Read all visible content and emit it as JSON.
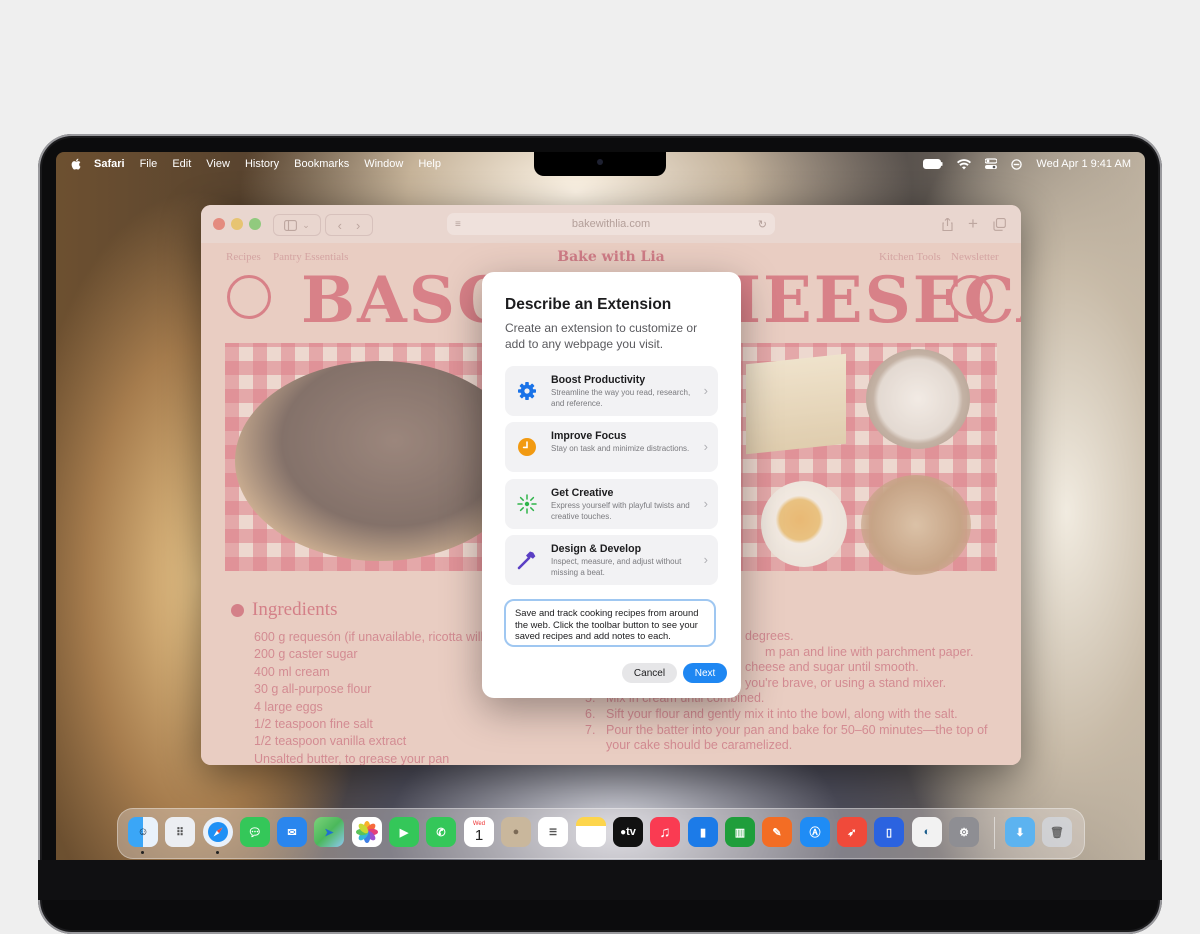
{
  "menubar": {
    "items": [
      "Safari",
      "File",
      "Edit",
      "View",
      "History",
      "Bookmarks",
      "Window",
      "Help"
    ],
    "clock": "Wed Apr 1  9:41 AM"
  },
  "safari": {
    "url": "bakewithlia.com"
  },
  "webpage": {
    "nav_left": [
      "Recipes",
      "Pantry Essentials"
    ],
    "brand": "Bake with Lia",
    "nav_right": [
      "Kitchen Tools",
      "Newsletter"
    ],
    "title": "BASQUE CHEESECAKE",
    "ingredients_heading": "Ingredients",
    "ingredients": [
      "600 g requesón (if unavailable, ricotta will w",
      "200 g caster sugar",
      "400 ml cream",
      "30 g all-purpose flour",
      "4 large eggs",
      "1/2 teaspoon fine salt",
      "1/2 teaspoon vanilla extract",
      "Unsalted butter, to grease your pan"
    ],
    "steps": [
      {
        "n": "",
        "text": "degrees."
      },
      {
        "n": "",
        "text": "m pan and line with parchment paper."
      },
      {
        "n": "",
        "text": "cheese and sugar until smooth."
      },
      {
        "n": "",
        "text": "you're brave, or using a stand mixer."
      },
      {
        "n": "5.",
        "text": "Mix in cream until combined."
      },
      {
        "n": "6.",
        "text": "Sift your flour and gently mix it into the bowl, along with the salt."
      },
      {
        "n": "7.",
        "text": "Pour the batter into your pan and bake for 50–60 minutes—the top of your cake should be caramelized."
      }
    ]
  },
  "dialog": {
    "title": "Describe an Extension",
    "subtitle": "Create an extension to customize or add to any webpage you visit.",
    "options": [
      {
        "title": "Boost Productivity",
        "desc": "Streamline the way you read, research, and reference.",
        "icon": "gear-icon",
        "color": "#1a73e8"
      },
      {
        "title": "Improve Focus",
        "desc": "Stay on task and minimize distractions.",
        "icon": "clock-icon",
        "color": "#f29a11"
      },
      {
        "title": "Get Creative",
        "desc": "Express yourself with playful twists and creative touches.",
        "icon": "sparkle-icon",
        "color": "#2fb44a"
      },
      {
        "title": "Design & Develop",
        "desc": "Inspect, measure, and adjust without missing a beat.",
        "icon": "hammer-icon",
        "color": "#5b3fc4"
      }
    ],
    "prompt_text": "Save and track cooking recipes from around the web. Click the toolbar button to see your saved recipes and add notes to each.",
    "cancel_label": "Cancel",
    "next_label": "Next"
  },
  "dock": {
    "calendar_month": "Wed",
    "calendar_day": "1",
    "tv_label": "tv",
    "apps": [
      {
        "name": "Finder",
        "color": "#2a8cf0"
      },
      {
        "name": "Launchpad",
        "color": "#e9e9ee"
      },
      {
        "name": "Safari",
        "color": "#1e90f5"
      },
      {
        "name": "Messages",
        "color": "#34c759"
      },
      {
        "name": "Mail",
        "color": "#2a86ee"
      },
      {
        "name": "Maps",
        "color": "#4bb85b"
      },
      {
        "name": "Photos",
        "color": "#f4f4f4"
      },
      {
        "name": "FaceTime",
        "color": "#34c759"
      },
      {
        "name": "Phone",
        "color": "#34c759"
      },
      {
        "name": "Calendar",
        "color": "#ffffff"
      },
      {
        "name": "Contacts",
        "color": "#c9b79c"
      },
      {
        "name": "Reminders",
        "color": "#ffffff"
      },
      {
        "name": "Notes",
        "color": "#fdd54c"
      },
      {
        "name": "TV",
        "color": "#111111"
      },
      {
        "name": "Music",
        "color": "#fa3b52"
      },
      {
        "name": "Keynote",
        "color": "#1c7be8"
      },
      {
        "name": "Numbers",
        "color": "#1f9e3b"
      },
      {
        "name": "Pages",
        "color": "#f36d24"
      },
      {
        "name": "App Store",
        "color": "#1f8cf5"
      },
      {
        "name": "Rocket",
        "color": "#f04a3a"
      },
      {
        "name": "Simulator",
        "color": "#2b63e0"
      },
      {
        "name": "Instruments",
        "color": "#f2f2f2"
      },
      {
        "name": "System Settings",
        "color": "#8e8e93"
      }
    ]
  }
}
